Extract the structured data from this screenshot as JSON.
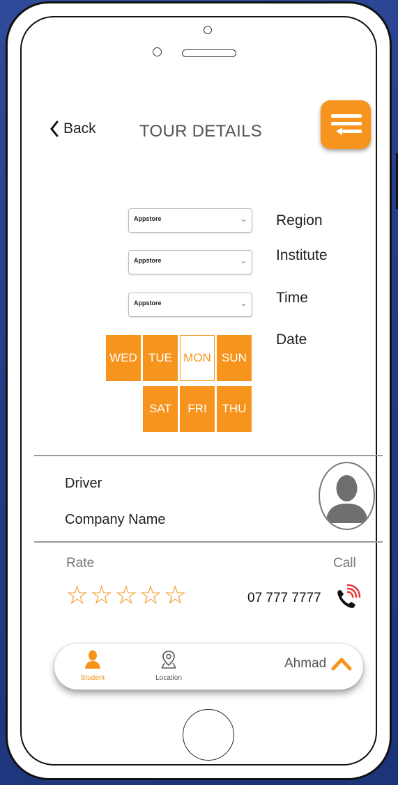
{
  "header": {
    "back_label": "Back",
    "title": "TOUR DETAILS",
    "menu_icon": "menu-collapse-icon"
  },
  "filters": {
    "region": {
      "label": "Region",
      "value": "Appstore"
    },
    "institute": {
      "label": "Institute",
      "value": "Appstore"
    },
    "time": {
      "label": "Time",
      "value": "Appstore"
    },
    "date": {
      "label": "Date"
    }
  },
  "days": {
    "row1": [
      "WED",
      "TUE",
      "MON",
      "SUN"
    ],
    "row2": [
      "SAT",
      "FRI",
      "THU"
    ],
    "selected": "MON"
  },
  "driver": {
    "driver_label": "Driver",
    "company_label": "Company Name",
    "avatar_icon": "user-avatar-icon"
  },
  "rating": {
    "rate_label": "Rate",
    "stars_total": 5,
    "stars_filled": 0
  },
  "contact": {
    "call_label": "Call",
    "phone": "07 777 7777",
    "call_icon": "phone-call-icon"
  },
  "bottom_nav": {
    "student_label": "Student",
    "location_label": "Location",
    "user_name": "Ahmad",
    "active": "Student"
  },
  "colors": {
    "accent": "#f7941d",
    "background": "#223c86",
    "call_red": "#e53935"
  }
}
